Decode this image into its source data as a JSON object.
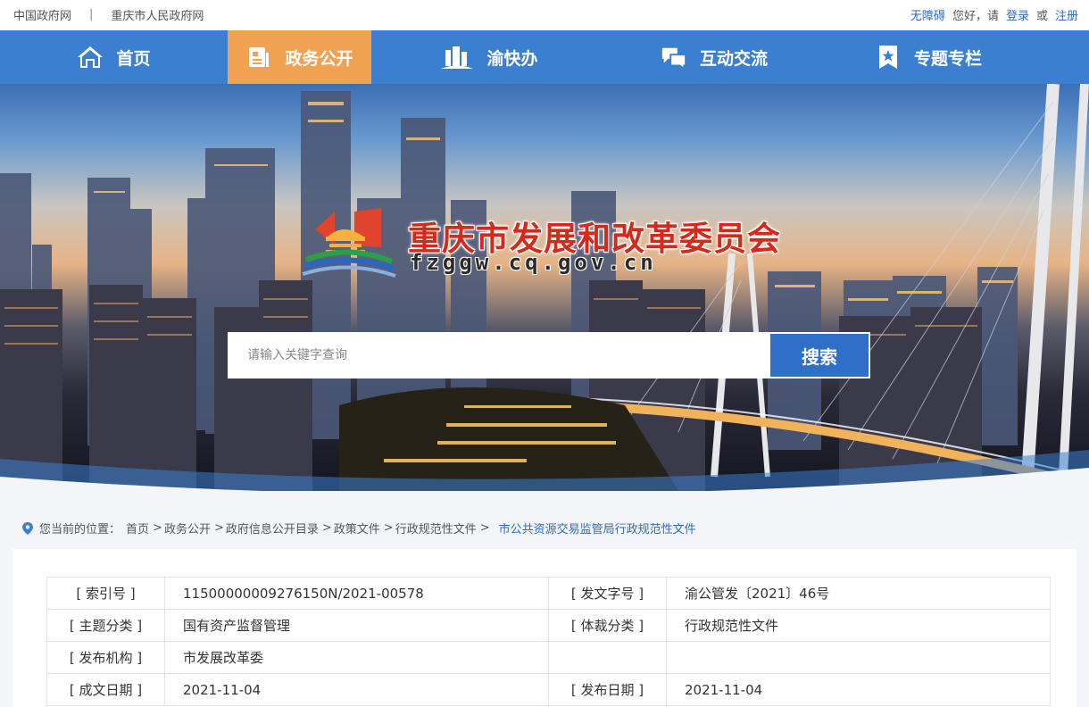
{
  "topbar": {
    "links_left": [
      "中国政府网",
      "重庆市人民政府网"
    ],
    "divider": "|",
    "accessibility": "无障碍",
    "greeting": "您好，请",
    "login": "登录",
    "or": "或",
    "register": "注册"
  },
  "nav": {
    "items": [
      {
        "label": "首页",
        "icon": "home-icon"
      },
      {
        "label": "政务公开",
        "icon": "document-icon"
      },
      {
        "label": "渝快办",
        "icon": "building-icon"
      },
      {
        "label": "互动交流",
        "icon": "chat-icon"
      },
      {
        "label": "专题专栏",
        "icon": "star-bookmark-icon"
      }
    ],
    "active_index": 1
  },
  "banner": {
    "title": "重庆市发展和改革委员会",
    "domain": "fzggw.cq.gov.cn"
  },
  "search": {
    "placeholder": "请输入关键字查询",
    "button": "搜索"
  },
  "breadcrumb": {
    "prefix": "您当前的位置：",
    "items": [
      "首页",
      "政务公开",
      "政府信息公开目录",
      "政策文件",
      "行政规范性文件"
    ],
    "separator": ">",
    "current": "市公共资源交易监管局行政规范性文件"
  },
  "info_table": {
    "rows": [
      {
        "k1": "[ 索引号 ]",
        "v1": "11500000009276150N/2021-00578",
        "k2": "[ 发文字号 ]",
        "v2": "渝公管发〔2021〕46号"
      },
      {
        "k1": "[ 主题分类 ]",
        "v1": "国有资产监督管理",
        "k2": "[ 体裁分类 ]",
        "v2": "行政规范性文件"
      },
      {
        "k1": "[ 发布机构 ]",
        "v1": "市发展改革委",
        "k2": "",
        "v2": ""
      },
      {
        "k1": "[ 成文日期 ]",
        "v1": "2021-11-04",
        "k2": "[ 发布日期 ]",
        "v2": "2021-11-04"
      }
    ]
  },
  "colors": {
    "nav_bg": "#3a7fd0",
    "nav_active": "#f0a151",
    "link_blue": "#2f6bc1",
    "title_red": "#d42a1c",
    "search_btn": "#2f6fc8"
  }
}
